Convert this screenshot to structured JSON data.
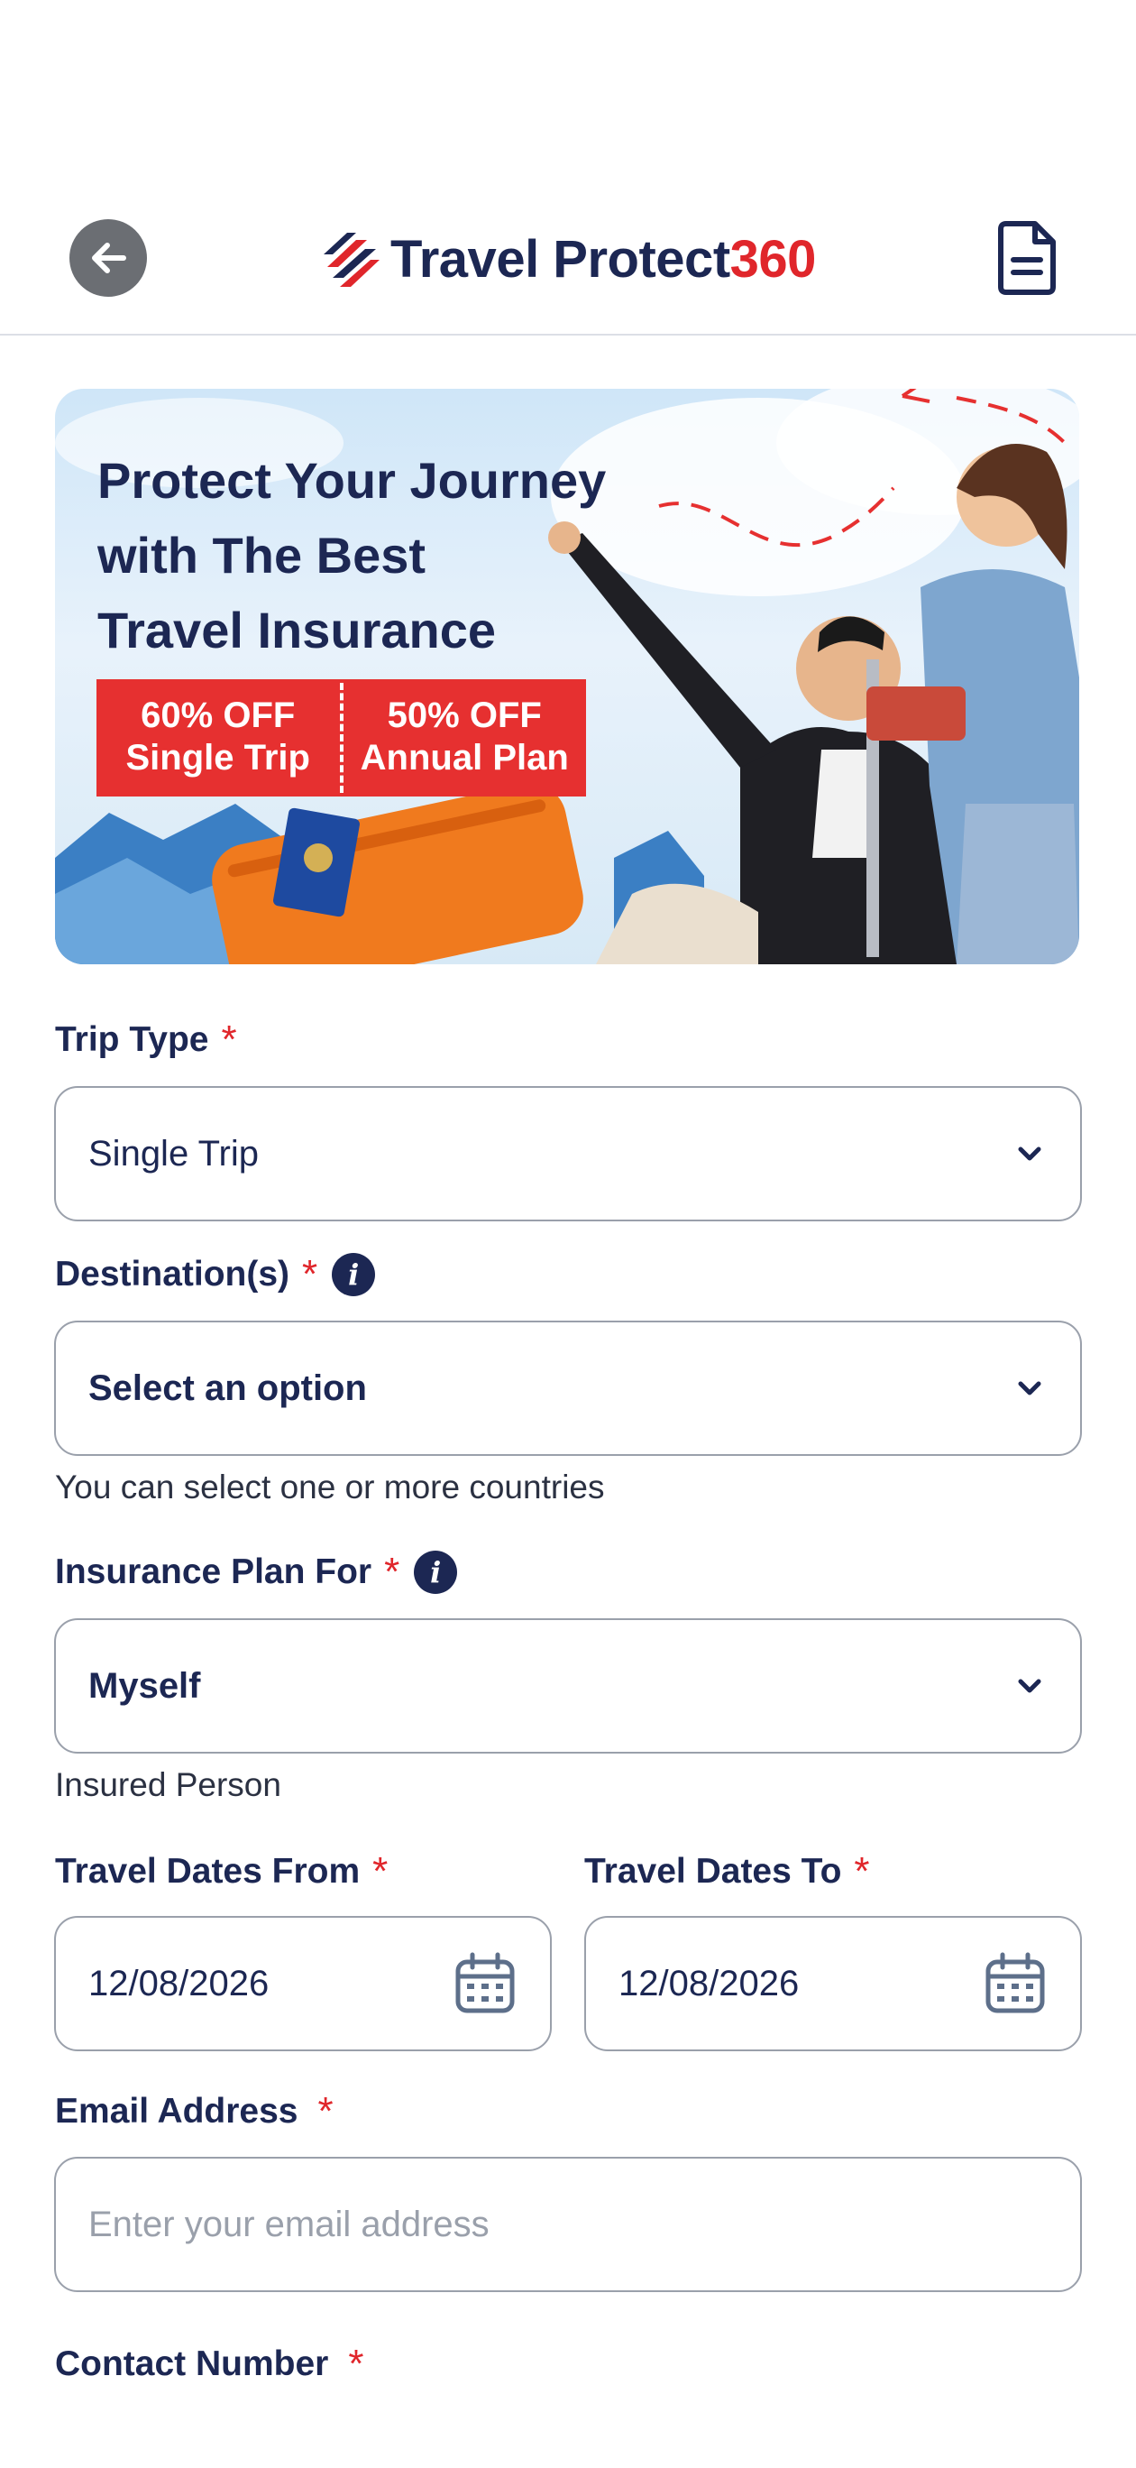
{
  "header": {
    "brand_main": "Travel Protect",
    "brand_accent": "360"
  },
  "banner": {
    "title_line1": "Protect Your Journey",
    "title_line2": "with The Best",
    "title_line3": "Travel Insurance",
    "offer1_line1": "60% OFF",
    "offer1_line2": "Single Trip",
    "offer2_line1": "50% OFF",
    "offer2_line2": "Annual Plan"
  },
  "form": {
    "trip_type": {
      "label": "Trip Type",
      "required": "*",
      "value": "Single Trip"
    },
    "destinations": {
      "label": "Destination(s)",
      "required": "*",
      "value": "Select an option",
      "helper": "You can select one or more countries"
    },
    "plan_for": {
      "label": "Insurance Plan For",
      "required": "*",
      "value": "Myself",
      "helper": "Insured Person"
    },
    "date_from": {
      "label": "Travel Dates From",
      "required": "*",
      "value": "12/08/2026"
    },
    "date_to": {
      "label": "Travel Dates To",
      "required": "*",
      "value": "12/08/2026"
    },
    "email": {
      "label": "Email Address",
      "required": "*",
      "placeholder": "Enter your email address"
    },
    "contact": {
      "label": "Contact Number",
      "required": "*"
    }
  },
  "colors": {
    "brand_navy": "#1c2753",
    "brand_red": "#e0262b",
    "offer_red": "#e63030"
  },
  "icons": [
    "back-arrow-icon",
    "logo-mark-icon",
    "document-icon",
    "info-icon",
    "chevron-down-icon",
    "calendar-icon"
  ]
}
